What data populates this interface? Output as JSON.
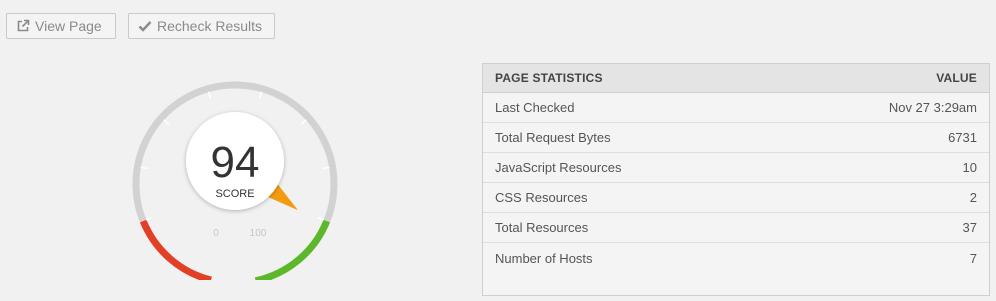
{
  "toolbar": {
    "view_page_label": "View Page",
    "recheck_label": "Recheck Results"
  },
  "score": {
    "value": "94",
    "label": "SCORE",
    "min_label": "0",
    "max_label": "100",
    "level": 94
  },
  "colors": {
    "good": "#5cb82a",
    "bad": "#e23f27",
    "track": "#d2d2d2",
    "needle": "#f39c11"
  },
  "stats": {
    "header_name": "PAGE STATISTICS",
    "header_value": "VALUE",
    "rows": [
      {
        "name": "Last Checked",
        "value": "Nov 27 3:29am"
      },
      {
        "name": "Total Request Bytes",
        "value": "6731"
      },
      {
        "name": "JavaScript Resources",
        "value": "10"
      },
      {
        "name": "CSS Resources",
        "value": "2"
      },
      {
        "name": "Total Resources",
        "value": "37"
      },
      {
        "name": "Number of Hosts",
        "value": "7"
      }
    ]
  }
}
